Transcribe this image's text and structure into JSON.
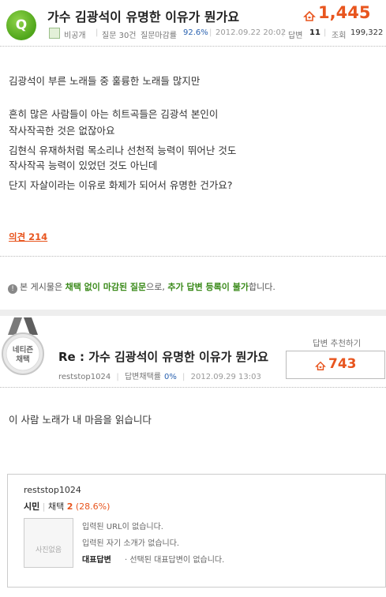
{
  "question": {
    "badge": "Q",
    "title": "가수 김광석이 유명한 이유가 뭔가요",
    "likes": "1,445",
    "author": "비공개",
    "questions_label": "질문 30건",
    "close_rate_label": "질문마감률",
    "close_rate": "92.6%",
    "datetime": "2012.09.22 20:02",
    "answers_label": "답변",
    "answers": "11",
    "views_label": "조회",
    "views": "199,322",
    "body": [
      "김광석이 부른 노래들 중 훌륭한 노래들 많지만",
      "흔히 많은 사람들이 아는 히트곡들은 김광석 본인이",
      " 작사작곡한 것은 없잖아요",
      "김현식 유재하처럼 목소리나 선천적 능력이 뛰어난 것도",
      "작사작곡 능력이 있었던 것도 아닌데",
      "단지 자살이라는 이유로 화제가 되어서 유명한 건가요?"
    ],
    "opinion": "의견 214"
  },
  "notice": {
    "icon": "!",
    "pre": "본 게시물은 ",
    "g1": "채택 없이 마감된 질문",
    "mid": "으로, ",
    "g2": "추가 답변 등록이 불가",
    "post": "합니다."
  },
  "answer": {
    "ribbon_line1": "네티즌",
    "ribbon_line2": "채택",
    "title": "Re : 가수 김광석이 유명한 이유가 뭔가요",
    "author": "reststop1024",
    "adopt_label": "답변채택률",
    "adopt_rate": "0%",
    "datetime": "2012.09.29 13:03",
    "recommend_label": "답변 추천하기",
    "recommend_count": "743",
    "body": "이 사람 노래가 내 마음을 읽습니다"
  },
  "profile": {
    "name": "reststop1024",
    "grade": "시민",
    "adopt_label": "채택",
    "adopt_count": "2",
    "adopt_pct": "(28.6%)",
    "photo_placeholder": "사진없음",
    "no_url": "입력된 URL이 없습니다.",
    "no_intro": "입력된 자기 소개가 없습니다.",
    "rep_answer_label": "대표답변",
    "rep_answer_text": "· 선택된 대표답변이 없습니다."
  },
  "colors": {
    "accent_orange": "#e8551e",
    "green": "#3a8a1a",
    "blue": "#2a62b0"
  }
}
